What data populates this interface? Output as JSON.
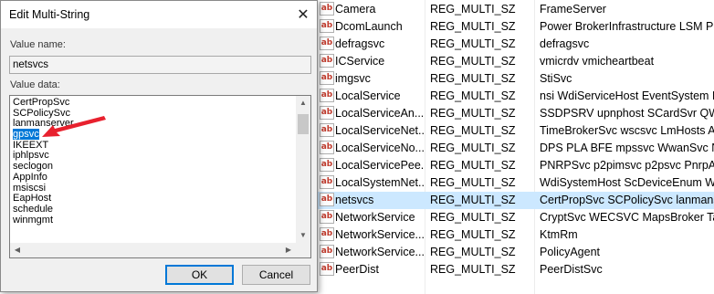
{
  "dialog": {
    "title": "Edit Multi-String",
    "close_glyph": "✕",
    "value_name_label": "Value name:",
    "value_name": "netsvcs",
    "value_data_label": "Value data:",
    "value_data_lines": [
      "CertPropSvc",
      "SCPolicySvc",
      "lanmanserver",
      "gpsvc",
      "IKEEXT",
      "iphlpsvc",
      "seclogon",
      "AppInfo",
      "msiscsi",
      "EapHost",
      "schedule",
      "winmgmt"
    ],
    "selected_line": "gpsvc",
    "ok_label": "OK",
    "cancel_label": "Cancel",
    "scroll_up_glyph": "▲",
    "scroll_down_glyph": "▼",
    "scroll_left_glyph": "◀",
    "scroll_right_glyph": "▶",
    "annotation_arrow_color": "#e8212e"
  },
  "registry": {
    "icon_text": "ab",
    "rows": [
      {
        "name": "Camera",
        "type": "REG_MULTI_SZ",
        "data": "FrameServer"
      },
      {
        "name": "DcomLaunch",
        "type": "REG_MULTI_SZ",
        "data": "Power BrokerInfrastructure LSM P"
      },
      {
        "name": "defragsvc",
        "type": "REG_MULTI_SZ",
        "data": "defragsvc"
      },
      {
        "name": "ICService",
        "type": "REG_MULTI_SZ",
        "data": "vmicrdv vmicheartbeat"
      },
      {
        "name": "imgsvc",
        "type": "REG_MULTI_SZ",
        "data": "StiSvc"
      },
      {
        "name": "LocalService",
        "type": "REG_MULTI_SZ",
        "data": "nsi WdiServiceHost EventSystem F"
      },
      {
        "name": "LocalServiceAn...",
        "type": "REG_MULTI_SZ",
        "data": "SSDPSRV upnphost SCardSvr QWA"
      },
      {
        "name": "LocalServiceNet...",
        "type": "REG_MULTI_SZ",
        "data": "TimeBrokerSvc wscsvc LmHosts A"
      },
      {
        "name": "LocalServiceNo...",
        "type": "REG_MULTI_SZ",
        "data": "DPS PLA BFE mpssvc WwanSvc N"
      },
      {
        "name": "LocalServicePee...",
        "type": "REG_MULTI_SZ",
        "data": "PNRPSvc p2pimsvc p2psvc PnrpA"
      },
      {
        "name": "LocalSystemNet...",
        "type": "REG_MULTI_SZ",
        "data": "WdiSystemHost ScDeviceEnum W"
      },
      {
        "name": "netsvcs",
        "type": "REG_MULTI_SZ",
        "data": "CertPropSvc SCPolicySvc lanmans",
        "selected": true
      },
      {
        "name": "NetworkService",
        "type": "REG_MULTI_SZ",
        "data": "CryptSvc WECSVC MapsBroker Ta"
      },
      {
        "name": "NetworkService...",
        "type": "REG_MULTI_SZ",
        "data": "KtmRm"
      },
      {
        "name": "NetworkService...",
        "type": "REG_MULTI_SZ",
        "data": "PolicyAgent"
      },
      {
        "name": "PeerDist",
        "type": "REG_MULTI_SZ",
        "data": "PeerDistSvc"
      }
    ]
  }
}
